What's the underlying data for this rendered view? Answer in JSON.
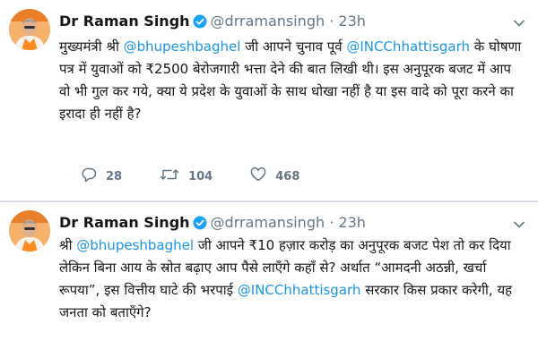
{
  "tweets": [
    {
      "author_name": "Dr Raman Singh",
      "handle": "@drramansingh",
      "separator": "·",
      "time": "23h",
      "text_parts": [
        {
          "t": "मुख्यमंत्री श्री ",
          "k": "text"
        },
        {
          "t": "@bhupeshbaghel",
          "k": "mention"
        },
        {
          "t": " जी आपने चुनाव पूर्व ",
          "k": "text"
        },
        {
          "t": "@INCChhattisgarh",
          "k": "mention"
        },
        {
          "t": " के घोषणा पत्र में युवाओं को ₹2500 बेरोजगारी भत्ता देने की बात लिखी थी। इस अनुपूरक बजट में आप वो भी गुल कर गये, क्या ये प्रदेश के युवाओं के साथ धोखा नहीं है या इस वादे को पूरा करने का इरादा ही नहीं है?",
          "k": "text"
        }
      ],
      "replies": "28",
      "retweets": "104",
      "likes": "468"
    },
    {
      "author_name": "Dr Raman Singh",
      "handle": "@drramansingh",
      "separator": "·",
      "time": "23h",
      "text_parts": [
        {
          "t": "श्री ",
          "k": "text"
        },
        {
          "t": "@bhupeshbaghel",
          "k": "mention"
        },
        {
          "t": " जी आपने ₹10 हज़ार करोड़ का अनुपूरक बजट पेश तो कर दिया लेकिन बिना आय के स्रोत बढ़ाए आप पैसे लाएँगे कहाँ से? अर्थात “आमदनी अठन्नी, खर्चा रूपया”, इस वित्तीय घाटे की भरपाई ",
          "k": "text"
        },
        {
          "t": "@INCChhattisgarh",
          "k": "mention"
        },
        {
          "t": " सरकार किस प्रकार करेगी, यह जनता को बताएँगे?",
          "k": "text"
        }
      ]
    }
  ],
  "icons": {
    "verified": "verified-badge-icon",
    "caret": "chevron-down-icon",
    "reply": "reply-icon",
    "retweet": "retweet-icon",
    "like": "heart-icon"
  },
  "colors": {
    "link": "#1b95e0",
    "verified": "#1da1f2",
    "muted": "#657786",
    "text": "#14171a"
  }
}
